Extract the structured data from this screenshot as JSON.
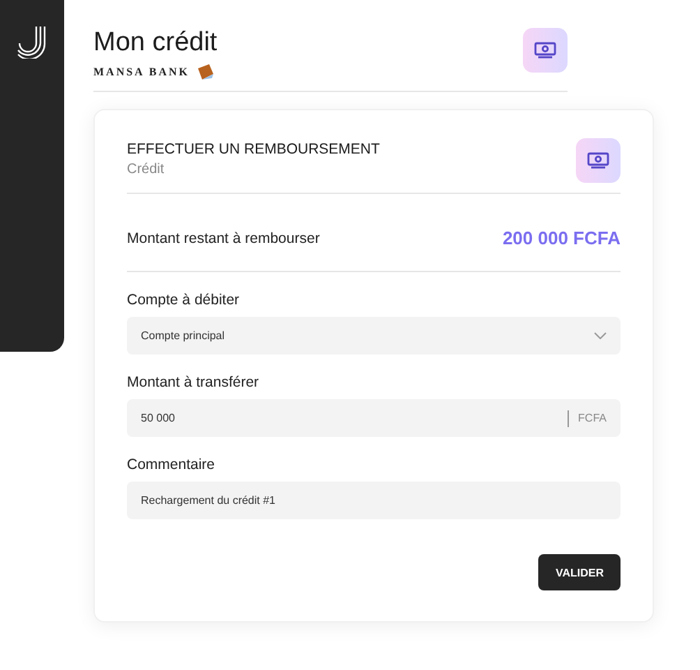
{
  "header": {
    "title": "Mon crédit",
    "brand": "MANSA BANK"
  },
  "card": {
    "title": "EFFECTUER UN REMBOURSEMENT",
    "subtitle": "Crédit"
  },
  "balance": {
    "label": "Montant restant à rembourser",
    "value": "200 000 FCFA"
  },
  "fields": [
    {
      "kind": "select",
      "label": "Compte à débiter",
      "value": "Compte principal"
    },
    {
      "kind": "amount",
      "label": "Montant à transférer",
      "value": "50 000",
      "suffix": "FCFA"
    },
    {
      "kind": "text",
      "label": "Commentaire",
      "value": "Rechargement du crédit #1"
    }
  ],
  "submit": "VALIDER"
}
